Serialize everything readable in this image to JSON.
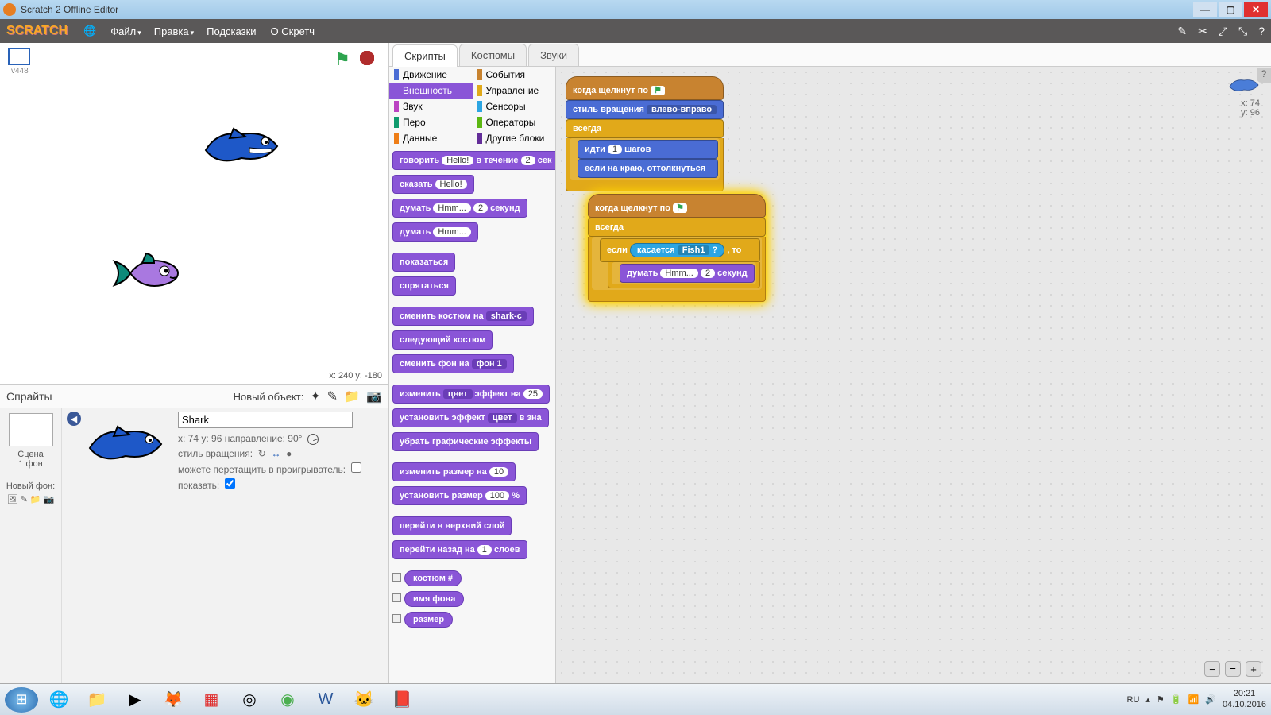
{
  "window": {
    "title": "Scratch 2 Offline Editor"
  },
  "menu": {
    "file": "Файл",
    "edit": "Правка",
    "tips": "Подсказки",
    "about": "О Скретч",
    "logo": "SCRATCH"
  },
  "stage": {
    "version": "v448",
    "coords": "x: 240   y: -180"
  },
  "sprites": {
    "header": "Спрайты",
    "newobj": "Новый объект:",
    "stage_label": "Сцена",
    "backdrop_count": "1 фон",
    "new_backdrop": "Новый фон:"
  },
  "sprite_info": {
    "name": "Shark",
    "pos": "x: 74    y: 96   направление: 90°",
    "rotation_label": "стиль вращения:",
    "drag_label": "можете перетащить в проигрыватель:",
    "show_label": "показать:"
  },
  "tabs": {
    "scripts": "Скрипты",
    "costumes": "Костюмы",
    "sounds": "Звуки"
  },
  "categories": {
    "motion": "Движение",
    "looks": "Внешность",
    "sound": "Звук",
    "pen": "Перо",
    "data": "Данные",
    "events": "События",
    "control": "Управление",
    "sensing": "Сенсоры",
    "operators": "Операторы",
    "more": "Другие блоки"
  },
  "palette_blocks": {
    "say_secs": {
      "t1": "говорить",
      "v1": "Hello!",
      "t2": "в течение",
      "v2": "2",
      "t3": "сек"
    },
    "say": {
      "t1": "сказать",
      "v1": "Hello!"
    },
    "think_secs": {
      "t1": "думать",
      "v1": "Hmm...",
      "v2": "2",
      "t2": "секунд"
    },
    "think": {
      "t1": "думать",
      "v1": "Hmm..."
    },
    "show": "показаться",
    "hide": "спрятаться",
    "switch_costume": {
      "t1": "сменить костюм на",
      "v1": "shark-c"
    },
    "next_costume": "следующий костюм",
    "switch_backdrop": {
      "t1": "сменить фон на",
      "v1": "фон 1"
    },
    "change_effect": {
      "t1": "изменить",
      "d1": "цвет",
      "t2": "эффект на",
      "v1": "25"
    },
    "set_effect": {
      "t1": "установить эффект",
      "d1": "цвет",
      "t2": "в зна"
    },
    "clear_effects": "убрать графические эффекты",
    "change_size": {
      "t1": "изменить размер на",
      "v1": "10"
    },
    "set_size": {
      "t1": "установить размер",
      "v1": "100",
      "t2": "%"
    },
    "front": "перейти в верхний слой",
    "back_layers": {
      "t1": "перейти назад на",
      "v1": "1",
      "t2": "слоев"
    },
    "costume_num": "костюм #",
    "backdrop_name": "имя фона",
    "size": "размер"
  },
  "script1": {
    "hat": "когда щелкнут по",
    "rot_style": {
      "t1": "стиль вращения",
      "v1": "влево-вправо"
    },
    "forever": "всегда",
    "move": {
      "t1": "идти",
      "v1": "1",
      "t2": "шагов"
    },
    "bounce": "если на краю, оттолкнуться"
  },
  "script2": {
    "hat": "когда щелкнут по",
    "forever": "всегда",
    "if": {
      "t1": "если",
      "t2": ", то"
    },
    "touching": {
      "t1": "касается",
      "v1": "Fish1",
      "q": "?"
    },
    "think": {
      "t1": "думать",
      "v1": "Hmm...",
      "v2": "2",
      "t2": "секунд"
    }
  },
  "scripts_info": {
    "x": "x: 74",
    "y": "y: 96"
  },
  "taskbar": {
    "lang": "RU",
    "time": "20:21",
    "date": "04.10.2016"
  }
}
